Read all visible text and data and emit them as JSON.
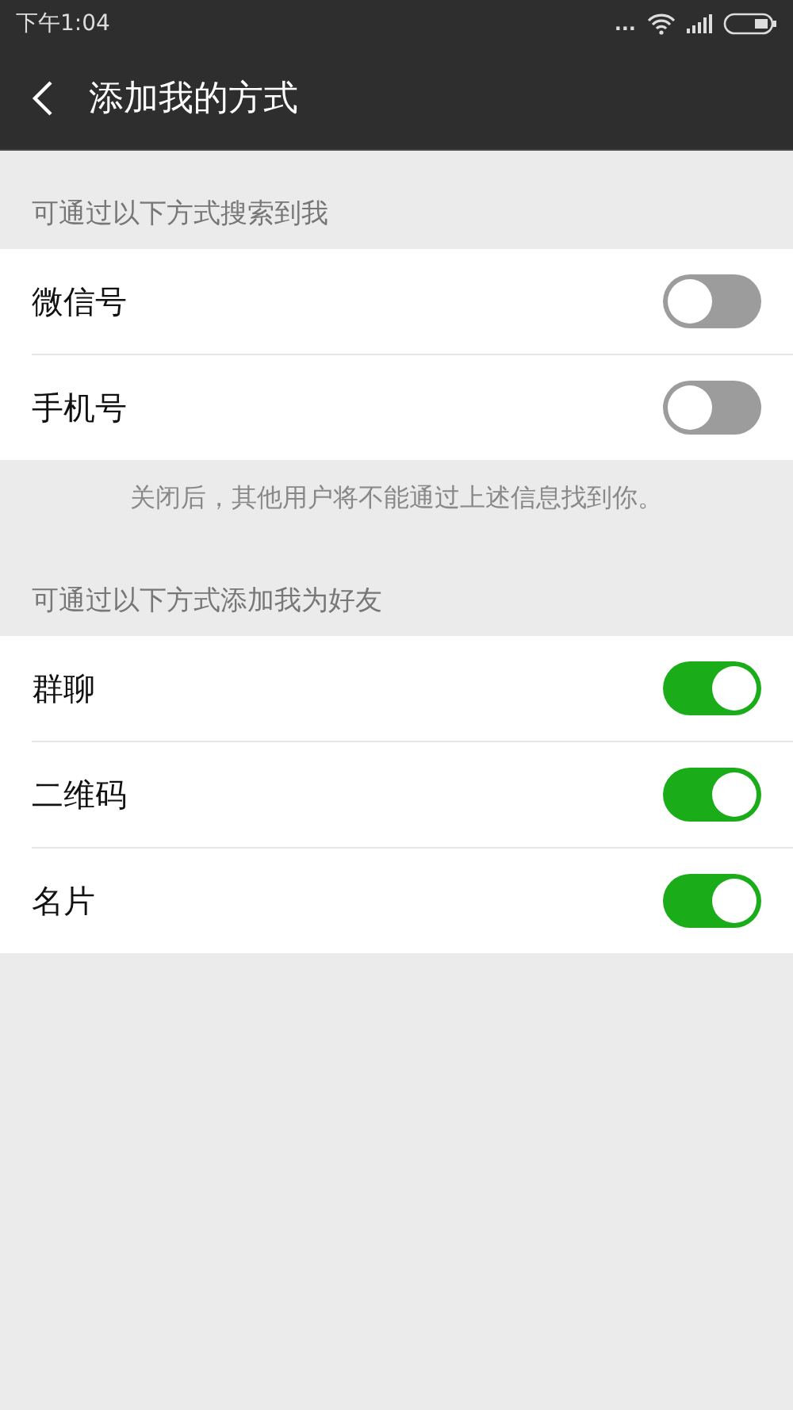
{
  "status_bar": {
    "time": "下午1:04",
    "more": "..."
  },
  "header": {
    "title": "添加我的方式"
  },
  "sections": [
    {
      "label": "可通过以下方式搜索到我",
      "rows": [
        {
          "label": "微信号",
          "on": false
        },
        {
          "label": "手机号",
          "on": false
        }
      ],
      "note": "关闭后，其他用户将不能通过上述信息找到你。"
    },
    {
      "label": "可通过以下方式添加我为好友",
      "rows": [
        {
          "label": "群聊",
          "on": true
        },
        {
          "label": "二维码",
          "on": true
        },
        {
          "label": "名片",
          "on": true
        }
      ]
    }
  ]
}
